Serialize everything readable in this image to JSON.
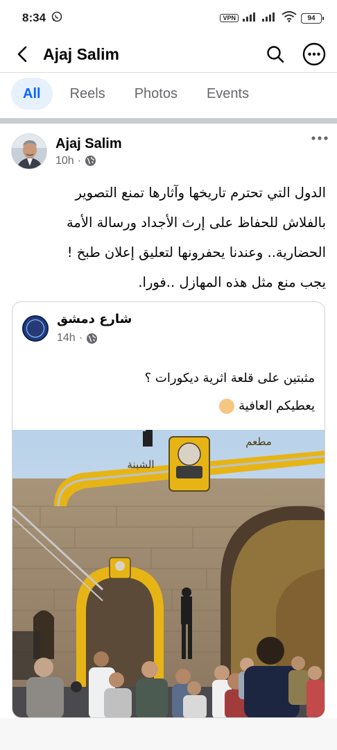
{
  "status_bar": {
    "time": "8:34",
    "vpn": "VPN",
    "battery": "94"
  },
  "header": {
    "title": "Ajaj Salim"
  },
  "tabs": [
    {
      "label": "All",
      "active": true
    },
    {
      "label": "Reels",
      "active": false
    },
    {
      "label": "Photos",
      "active": false
    },
    {
      "label": "Events",
      "active": false
    }
  ],
  "post": {
    "author": "Ajaj Salim",
    "time": "10h",
    "text_lines": [
      "الدول التي تحترم تاريخها وآثارها تمنع التصوير",
      "بالفلاش للحفاظ على إرث الأجداد ورسالة الأمة",
      "الحضارية..  وعندنا يحفرونها لتعليق إعلان طبخ !",
      "يجب منع مثل هذه المهازل ..فورا."
    ],
    "shared": {
      "page_name": "شارع دمشق",
      "time": "14h",
      "text_lines": [
        "مثبتين على قلعة اثرية ديكورات ؟",
        "يعطيكم العافية"
      ],
      "image_signs": [
        "الشبنة",
        "مطعم"
      ]
    }
  },
  "colors": {
    "accent": "#0866ff",
    "tab_active_bg": "#e7f0fd",
    "secondary_text": "#65676b",
    "sign_yellow": "#e7b416"
  }
}
